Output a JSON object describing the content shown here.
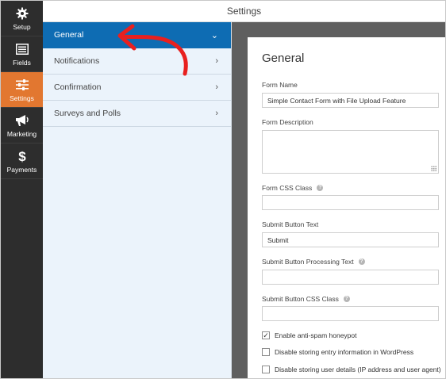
{
  "window": {
    "title": "Settings"
  },
  "rail": {
    "items": [
      {
        "label": "Setup",
        "icon": "gear-icon",
        "active": false
      },
      {
        "label": "Fields",
        "icon": "list-icon",
        "active": false
      },
      {
        "label": "Settings",
        "icon": "sliders-icon",
        "active": true
      },
      {
        "label": "Marketing",
        "icon": "megaphone-icon",
        "active": false
      },
      {
        "label": "Payments",
        "icon": "dollar-icon",
        "active": false
      }
    ],
    "colors": {
      "background": "#2d2d2d",
      "active": "#e27730"
    }
  },
  "sections": {
    "items": [
      {
        "label": "General",
        "active": true
      },
      {
        "label": "Notifications",
        "active": false
      },
      {
        "label": "Confirmation",
        "active": false
      },
      {
        "label": "Surveys and Polls",
        "active": false
      }
    ],
    "colors": {
      "active": "#0e6cb3",
      "background": "#ebf3fb"
    }
  },
  "general": {
    "title": "General",
    "form_name": {
      "label": "Form Name",
      "value": "Simple Contact Form with File Upload Feature"
    },
    "form_description": {
      "label": "Form Description",
      "value": ""
    },
    "form_css_class": {
      "label": "Form CSS Class",
      "value": ""
    },
    "submit_button_text": {
      "label": "Submit Button Text",
      "value": "Submit"
    },
    "submit_processing_text": {
      "label": "Submit Button Processing Text",
      "value": ""
    },
    "submit_css_class": {
      "label": "Submit Button CSS Class",
      "value": ""
    },
    "checkboxes": [
      {
        "label": "Enable anti-spam honeypot",
        "checked": true
      },
      {
        "label": "Disable storing entry information in WordPress",
        "checked": false
      },
      {
        "label": "Disable storing user details (IP address and user agent)",
        "checked": false
      }
    ]
  },
  "annotation": {
    "arrow_color": "#e8201f"
  }
}
